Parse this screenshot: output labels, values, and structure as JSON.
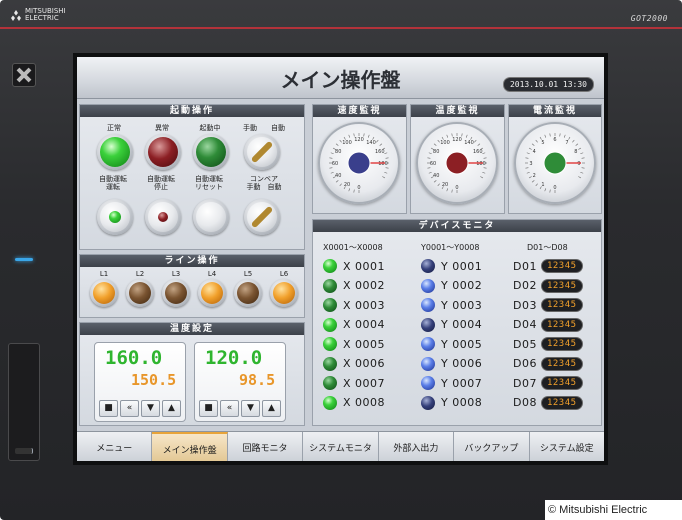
{
  "device": {
    "brand_line1": "MITSUBISHI",
    "brand_line2": "ELECTRIC",
    "model": "GOT2000",
    "copyright": "© Mitsubishi Electric"
  },
  "screen": {
    "title": "メイン操作盤",
    "clock": "2013.10.01 13:30"
  },
  "start_op": {
    "header": "起動操作",
    "row1": [
      {
        "label": "正常",
        "lamp": "green"
      },
      {
        "label": "異常",
        "lamp": "red"
      },
      {
        "label": "起動中",
        "lamp": "dgreen"
      },
      {
        "label": "手動　　自動",
        "lamp": "switch"
      }
    ],
    "row2": [
      {
        "label": "自動運転\n運転",
        "lamp": "green-small"
      },
      {
        "label": "自動運転\n停止",
        "lamp": "red-small"
      },
      {
        "label": "自動運転\nリセット",
        "lamp": "white"
      },
      {
        "label": "コンベア\n手動　自動",
        "lamp": "switch"
      }
    ]
  },
  "line_op": {
    "header": "ライン操作",
    "items": [
      {
        "label": "L1",
        "lamp": "orange"
      },
      {
        "label": "L2",
        "lamp": "brown"
      },
      {
        "label": "L3",
        "lamp": "brown"
      },
      {
        "label": "L4",
        "lamp": "orange"
      },
      {
        "label": "L5",
        "lamp": "brown"
      },
      {
        "label": "L6",
        "lamp": "orange"
      }
    ]
  },
  "temp_set": {
    "header": "温度設定",
    "boxes": [
      {
        "set": "160.0",
        "actual": "150.5"
      },
      {
        "set": "120.0",
        "actual": "98.5"
      }
    ],
    "buttons": [
      "■",
      "«",
      "▼",
      "▲"
    ]
  },
  "gauges": [
    {
      "header": "速度監視",
      "color": "#3a3f8c",
      "ticks": [
        "120",
        "100",
        "80",
        "60",
        "40",
        "20",
        "0",
        "140",
        "160",
        "180"
      ],
      "value": 90
    },
    {
      "header": "温度監視",
      "color": "#8c1f24",
      "ticks": [
        "120",
        "100",
        "80",
        "60",
        "40",
        "20",
        "0",
        "140",
        "160",
        "180"
      ],
      "value": 90
    },
    {
      "header": "電流監視",
      "color": "#2f8c38",
      "ticks": [
        "6",
        "5",
        "4",
        "3",
        "2",
        "1",
        "0",
        "7",
        "8",
        "9"
      ],
      "value": 4.5
    }
  ],
  "device_monitor": {
    "header": "デバイスモニタ",
    "col_x_head": "X0001～X0008",
    "col_y_head": "Y0001～Y0008",
    "col_d_head": "D01～D08",
    "x": [
      {
        "label": "X 0001",
        "state": "green"
      },
      {
        "label": "X 0002",
        "state": "dgreen"
      },
      {
        "label": "X 0003",
        "state": "dgreen"
      },
      {
        "label": "X 0004",
        "state": "green"
      },
      {
        "label": "X 0005",
        "state": "green"
      },
      {
        "label": "X 0006",
        "state": "dgreen"
      },
      {
        "label": "X 0007",
        "state": "dgreen"
      },
      {
        "label": "X 0008",
        "state": "green"
      }
    ],
    "y": [
      {
        "label": "Y 0001",
        "state": "dblue"
      },
      {
        "label": "Y 0002",
        "state": "blue"
      },
      {
        "label": "Y 0003",
        "state": "blue"
      },
      {
        "label": "Y 0004",
        "state": "dblue"
      },
      {
        "label": "Y 0005",
        "state": "blue"
      },
      {
        "label": "Y 0006",
        "state": "blue"
      },
      {
        "label": "Y 0007",
        "state": "blue"
      },
      {
        "label": "Y 0008",
        "state": "dblue"
      }
    ],
    "d": [
      {
        "label": "D01",
        "value": "12345"
      },
      {
        "label": "D02",
        "value": "12345"
      },
      {
        "label": "D03",
        "value": "12345"
      },
      {
        "label": "D04",
        "value": "12345"
      },
      {
        "label": "D05",
        "value": "12345"
      },
      {
        "label": "D06",
        "value": "12345"
      },
      {
        "label": "D07",
        "value": "12345"
      },
      {
        "label": "D08",
        "value": "12345"
      }
    ]
  },
  "tabs": [
    {
      "label": "メニュー",
      "active": false
    },
    {
      "label": "メイン操作盤",
      "active": true
    },
    {
      "label": "回路モニタ",
      "active": false
    },
    {
      "label": "システムモニタ",
      "active": false
    },
    {
      "label": "外部入出力",
      "active": false
    },
    {
      "label": "バックアップ",
      "active": false
    },
    {
      "label": "システム設定",
      "active": false
    }
  ]
}
